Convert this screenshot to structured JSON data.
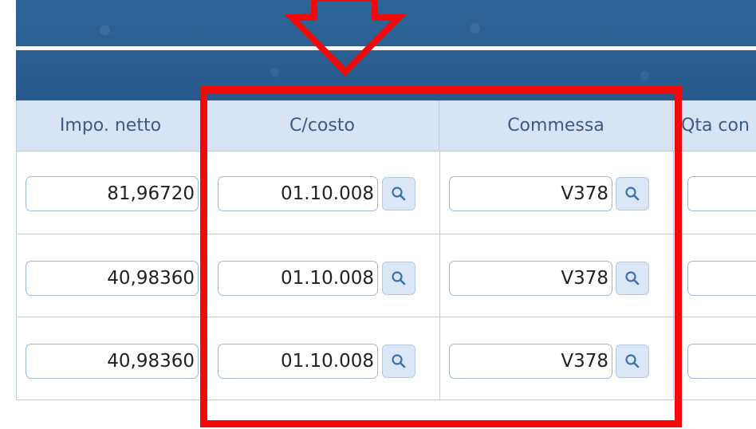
{
  "grid": {
    "columns": [
      {
        "label": "Impo. netto"
      },
      {
        "label": "C/costo"
      },
      {
        "label": "Commessa"
      },
      {
        "label": "Qta con"
      }
    ],
    "rows": [
      {
        "importo": "81,96720",
        "centro_costo": "01.10.008",
        "commessa": "V378"
      },
      {
        "importo": "40,98360",
        "centro_costo": "01.10.008",
        "commessa": "V378"
      },
      {
        "importo": "40,98360",
        "centro_costo": "01.10.008",
        "commessa": "V378"
      }
    ],
    "lookup_icon": "search-icon"
  },
  "annotation": {
    "highlight_color": "#f00a0a",
    "arrow_color": "#f00a0a"
  },
  "colors": {
    "banner": "#2a5f93",
    "header_bg": "#d6e4f6",
    "header_text": "#3d5a80",
    "border": "#b9cce3"
  }
}
